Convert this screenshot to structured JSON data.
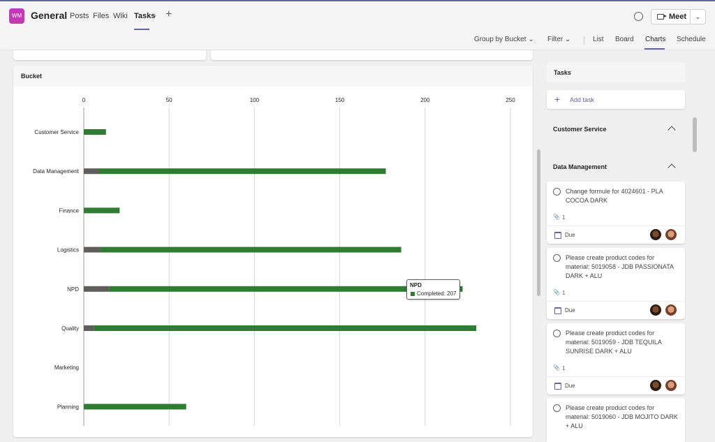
{
  "header": {
    "team_avatar": "WM",
    "channel": "General",
    "tabs": [
      "Posts",
      "Files",
      "Wiki",
      "Tasks"
    ],
    "active_tab": "Tasks",
    "add_tab_icon": "plus-icon",
    "meet_label": "Meet"
  },
  "toolbar": {
    "group_by": "Group by Bucket",
    "filter": "Filter",
    "views": [
      "List",
      "Board",
      "Charts",
      "Schedule"
    ],
    "active_view": "Charts"
  },
  "chart_panel": {
    "title": "Bucket",
    "tooltip": {
      "title": "NPD",
      "text": "Completed: 207"
    }
  },
  "chart_data": {
    "type": "bar",
    "orientation": "horizontal",
    "stacked": true,
    "title": "Bucket",
    "categories": [
      "Customer Service",
      "Data Management",
      "Finance",
      "Logistics",
      "NPD",
      "Quality",
      "Marketing",
      "Planning"
    ],
    "series": [
      {
        "name": "",
        "color": "#605e5c",
        "values": [
          0,
          9,
          0,
          10,
          15,
          6,
          0,
          0
        ]
      },
      {
        "name": "Completed",
        "color": "#2e7d32",
        "values": [
          13,
          168,
          21,
          176,
          207,
          224,
          0,
          60
        ]
      }
    ],
    "xlim": [
      0,
      250
    ],
    "xticks": [
      0,
      50,
      100,
      150,
      200,
      250
    ],
    "grid": true
  },
  "tasks": {
    "header": "Tasks",
    "add_label": "Add task",
    "buckets": [
      {
        "name": "Customer Service"
      },
      {
        "name": "Data Management"
      }
    ],
    "cards": [
      {
        "title": "Change formule for 4024601 - PLA COCOA DARK",
        "attachments": "1",
        "due": "Due"
      },
      {
        "title": "Please create product codes for material: 5019058 - JDB PASSIONATA DARK + ALU",
        "attachments": "1",
        "due": "Due"
      },
      {
        "title": "Please create product codes for material: 5019059 - JDB TEQUILA SUNRISE DARK + ALU",
        "attachments": "1",
        "due": "Due"
      },
      {
        "title": "Please create product codes for material: 5019060 - JDB MOJITO DARK + ALU"
      }
    ]
  }
}
